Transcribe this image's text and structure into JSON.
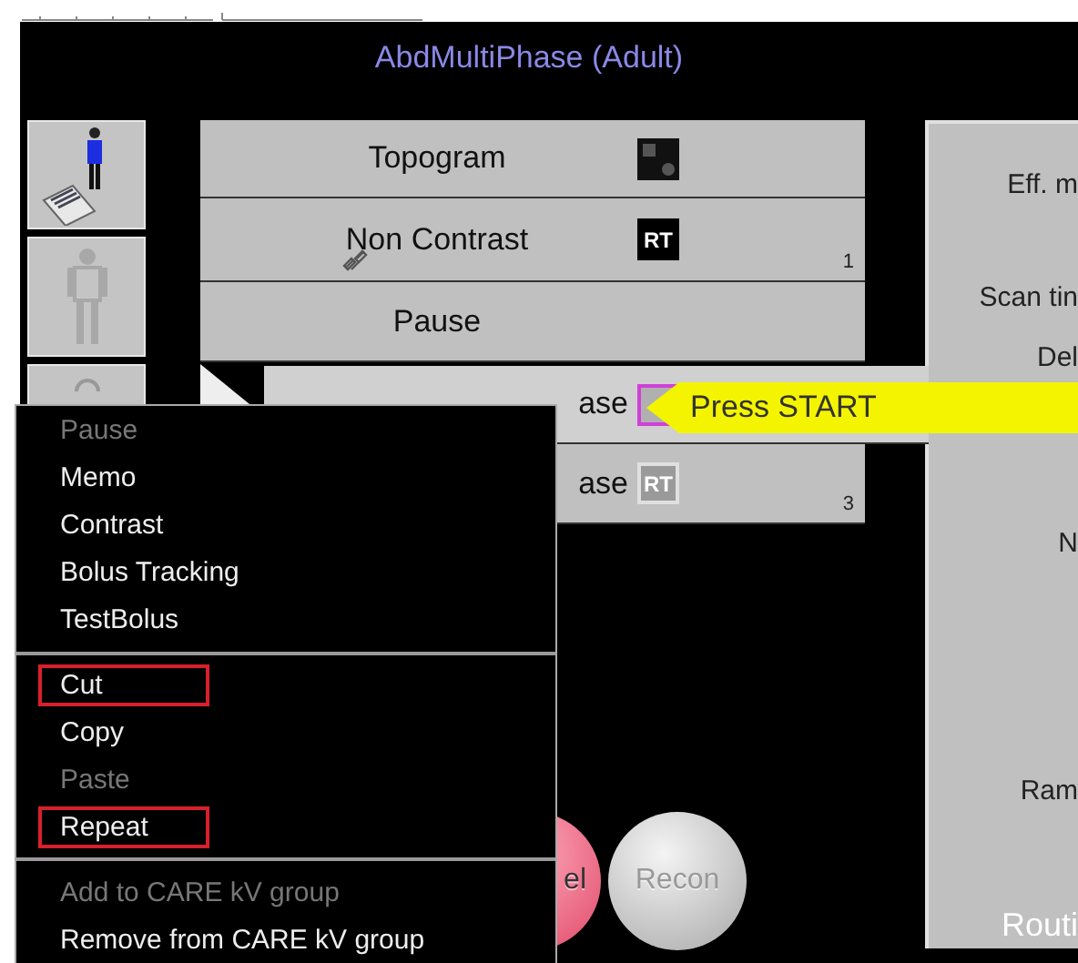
{
  "title": "AbdMultiPhase (Adult)",
  "patient_buttons": [
    {
      "kind": "patient-table"
    },
    {
      "kind": "body-grey"
    },
    {
      "kind": "partial"
    }
  ],
  "protocol": [
    {
      "label": "Topogram",
      "badge": {
        "kind": "scout"
      },
      "linked": false,
      "selected": false
    },
    {
      "label": "Non Contrast",
      "badge": {
        "kind": "rt-dark",
        "text": "RT"
      },
      "number": "1",
      "linked": true,
      "selected": false
    },
    {
      "label": "Pause",
      "linked": false,
      "selected": false
    },
    {
      "label": "ase",
      "badge": {
        "kind": "rt-pink"
      },
      "linked": false,
      "selected": true
    },
    {
      "label": "ase",
      "badge": {
        "kind": "rt-grey",
        "text": "RT"
      },
      "number": "3",
      "linked": false,
      "selected": false
    }
  ],
  "callout": {
    "text": "Press START"
  },
  "buttons": [
    {
      "label": "el",
      "kind": "cancel"
    },
    {
      "label": "Recon",
      "kind": "recon"
    }
  ],
  "panel": {
    "labels": [
      "Eff. m",
      "Scan tin",
      "Del",
      "N",
      "Ram"
    ],
    "footer": "Routi"
  },
  "menu": {
    "items": [
      {
        "kind": "item",
        "label": "Pause",
        "disabled": true,
        "outlined": false
      },
      {
        "kind": "item",
        "label": "Memo",
        "disabled": false,
        "outlined": false
      },
      {
        "kind": "item",
        "label": "Contrast",
        "disabled": false,
        "outlined": false
      },
      {
        "kind": "item",
        "label": "Bolus Tracking",
        "disabled": false,
        "outlined": false
      },
      {
        "kind": "item",
        "label": "TestBolus",
        "disabled": false,
        "outlined": false
      },
      {
        "kind": "separator"
      },
      {
        "kind": "item",
        "label": "Cut",
        "disabled": false,
        "outlined": true
      },
      {
        "kind": "item",
        "label": "Copy",
        "disabled": false,
        "outlined": false
      },
      {
        "kind": "item",
        "label": "Paste",
        "disabled": true,
        "outlined": false
      },
      {
        "kind": "item",
        "label": "Repeat",
        "disabled": false,
        "outlined": true
      },
      {
        "kind": "separator"
      },
      {
        "kind": "item",
        "label": "Add to CARE kV group",
        "disabled": true,
        "outlined": false
      },
      {
        "kind": "item",
        "label": "Remove from CARE kV group",
        "disabled": false,
        "outlined": false
      }
    ]
  }
}
